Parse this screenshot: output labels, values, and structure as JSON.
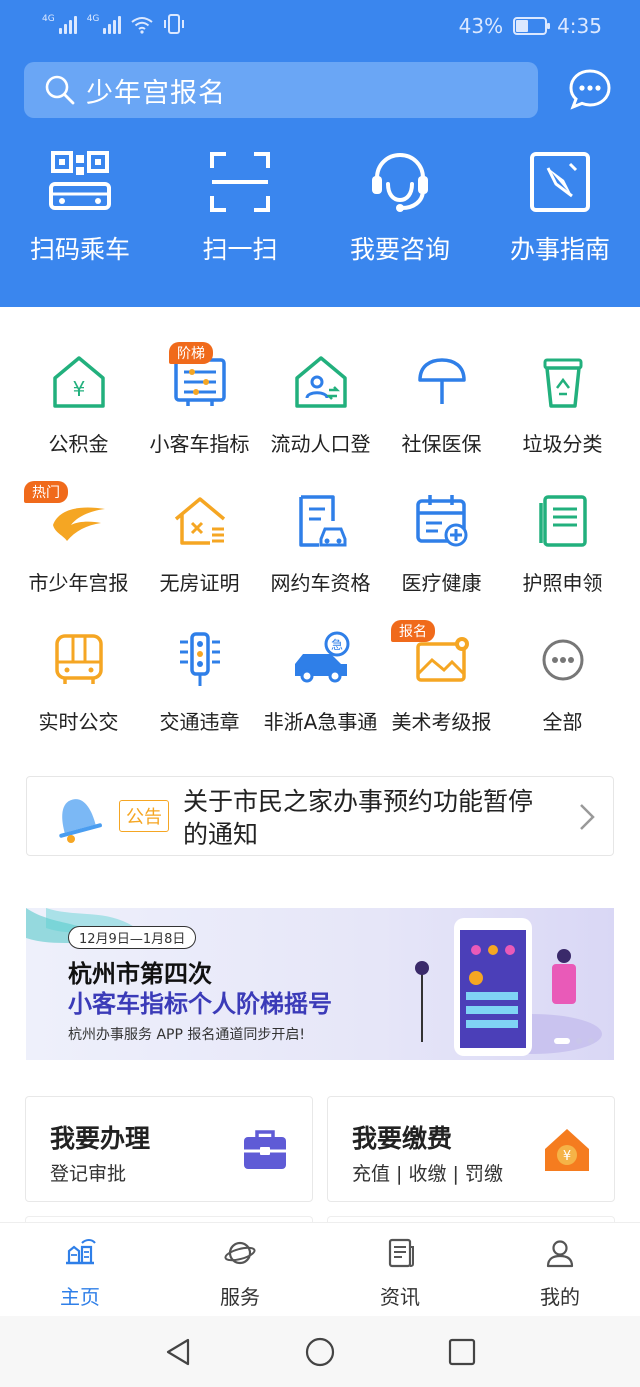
{
  "status": {
    "network1": "4G",
    "network2": "4G",
    "battery": "43%",
    "battery_level": 0.43,
    "time": "4:35"
  },
  "search": {
    "placeholder": "少年宫报名"
  },
  "quick_actions": [
    {
      "label": "扫码乘车",
      "icon": "qr-bus-icon"
    },
    {
      "label": "扫一扫",
      "icon": "scan-icon"
    },
    {
      "label": "我要咨询",
      "icon": "headset-icon"
    },
    {
      "label": "办事指南",
      "icon": "compass-icon"
    }
  ],
  "services": [
    {
      "label": "公积金",
      "icon": "fund-house-icon",
      "badge": ""
    },
    {
      "label": "小客车指标",
      "icon": "car-quota-icon",
      "badge": "阶梯"
    },
    {
      "label": "流动人口登",
      "icon": "population-icon",
      "badge": ""
    },
    {
      "label": "社保医保",
      "icon": "umbrella-icon",
      "badge": ""
    },
    {
      "label": "垃圾分类",
      "icon": "recycle-bin-icon",
      "badge": ""
    },
    {
      "label": "市少年宫报",
      "icon": "youth-palace-icon",
      "badge": "热门"
    },
    {
      "label": "无房证明",
      "icon": "no-house-icon",
      "badge": ""
    },
    {
      "label": "网约车资格",
      "icon": "rideshare-icon",
      "badge": ""
    },
    {
      "label": "医疗健康",
      "icon": "medical-calendar-icon",
      "badge": ""
    },
    {
      "label": "护照申领",
      "icon": "passport-icon",
      "badge": ""
    },
    {
      "label": "实时公交",
      "icon": "bus-icon",
      "badge": ""
    },
    {
      "label": "交通违章",
      "icon": "traffic-light-icon",
      "badge": ""
    },
    {
      "label": "非浙A急事通",
      "icon": "urgent-car-icon",
      "badge": ""
    },
    {
      "label": "美术考级报",
      "icon": "art-picture-icon",
      "badge": "报名"
    },
    {
      "label": "全部",
      "icon": "more-icon",
      "badge": ""
    }
  ],
  "notice": {
    "tag": "公告",
    "text": "关于市民之家办事预约功能暂停的通知"
  },
  "banner": {
    "date": "12月9日—1月8日",
    "line1": "杭州市第四次",
    "line2": "小客车指标个人阶梯摇号",
    "line3": "杭州办事服务 APP 报名通道同步开启!"
  },
  "cards": [
    {
      "title": "我要办理",
      "subtitle": "登记审批",
      "icon": "briefcase-icon"
    },
    {
      "title": "我要缴费",
      "subtitle": "充值 | 收缴 | 罚缴",
      "icon": "payment-house-icon"
    }
  ],
  "tabs": [
    {
      "label": "主页",
      "icon": "home-icon",
      "active": true
    },
    {
      "label": "服务",
      "icon": "planet-icon",
      "active": false
    },
    {
      "label": "资讯",
      "icon": "news-icon",
      "active": false
    },
    {
      "label": "我的",
      "icon": "user-icon",
      "active": false
    }
  ],
  "colors": {
    "brand": "#3a86ee",
    "accent_green": "#22b07d",
    "accent_orange": "#f5a623",
    "accent_blue": "#2f7fe8",
    "badge": "#f06a1b"
  }
}
